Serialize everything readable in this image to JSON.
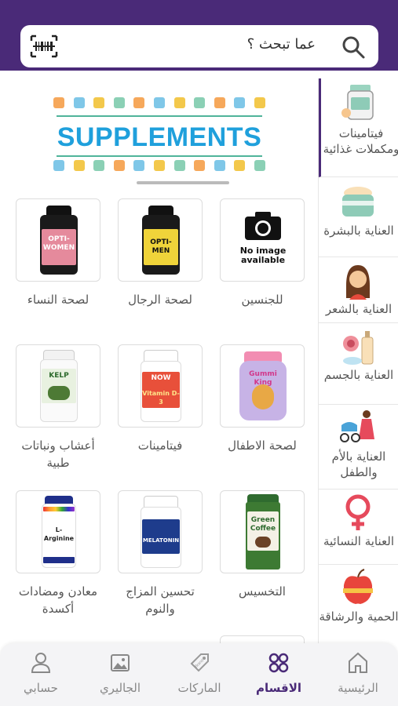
{
  "search": {
    "placeholder": "عما تبحث ؟"
  },
  "banner": {
    "title": "SUPPLEMENTS"
  },
  "categories": [
    {
      "label": "لصحة النساء",
      "image": "opti-women"
    },
    {
      "label": "لصحة الرجال",
      "image": "opti-men"
    },
    {
      "label": "للجنسين",
      "image": "no-image",
      "noimage_line1": "No image",
      "noimage_line2": "available"
    },
    {
      "label": "أعشاب ونباتات طبية",
      "image": "kelp"
    },
    {
      "label": "فيتامينات",
      "image": "vitamin-d3"
    },
    {
      "label": "لصحة الاطفال",
      "image": "gummi-king"
    },
    {
      "label": "معادن ومضادات أكسدة",
      "image": "l-arginine"
    },
    {
      "label": "تحسين المزاج والنوم",
      "image": "melatonin"
    },
    {
      "label": "التخسيس",
      "image": "green-coffee"
    }
  ],
  "products": {
    "opti_women": "OPTI-WOMEN",
    "opti_men": "OPTI-MEN",
    "kelp": "KELP",
    "now": "NOW",
    "vitd": "Vitamin D-3",
    "gummi": "Gummi King",
    "arginine": "L-Arginine",
    "melatonin": "MELATONIN",
    "coffee1": "Green",
    "coffee2": "Coffee"
  },
  "sidebar": [
    {
      "label": "فيتامينات ومكملات غذائية",
      "icon": "vitamins-jar-icon",
      "active": true
    },
    {
      "label": "العناية بالبشرة",
      "icon": "skin-cream-icon"
    },
    {
      "label": "العناية بالشعر",
      "icon": "hair-woman-icon"
    },
    {
      "label": "العناية بالجسم",
      "icon": "body-care-icon"
    },
    {
      "label": "العناية بالأم والطفل",
      "icon": "mother-baby-icon"
    },
    {
      "label": "العناية النسائية",
      "icon": "female-symbol-icon"
    },
    {
      "label": "الحمية والرشاقة",
      "icon": "diet-apple-icon"
    }
  ],
  "nav": [
    {
      "label": "الرئيسية",
      "icon": "home-icon"
    },
    {
      "label": "الاقسام",
      "icon": "categories-icon",
      "active": true
    },
    {
      "label": "الماركات",
      "icon": "brand-tag-icon",
      "badge": "Brand"
    },
    {
      "label": "الجاليري",
      "icon": "gallery-icon"
    },
    {
      "label": "حسابي",
      "icon": "user-icon"
    }
  ],
  "colors": {
    "brand": "#4a2a78",
    "banner_text": "#1fa0dc"
  }
}
